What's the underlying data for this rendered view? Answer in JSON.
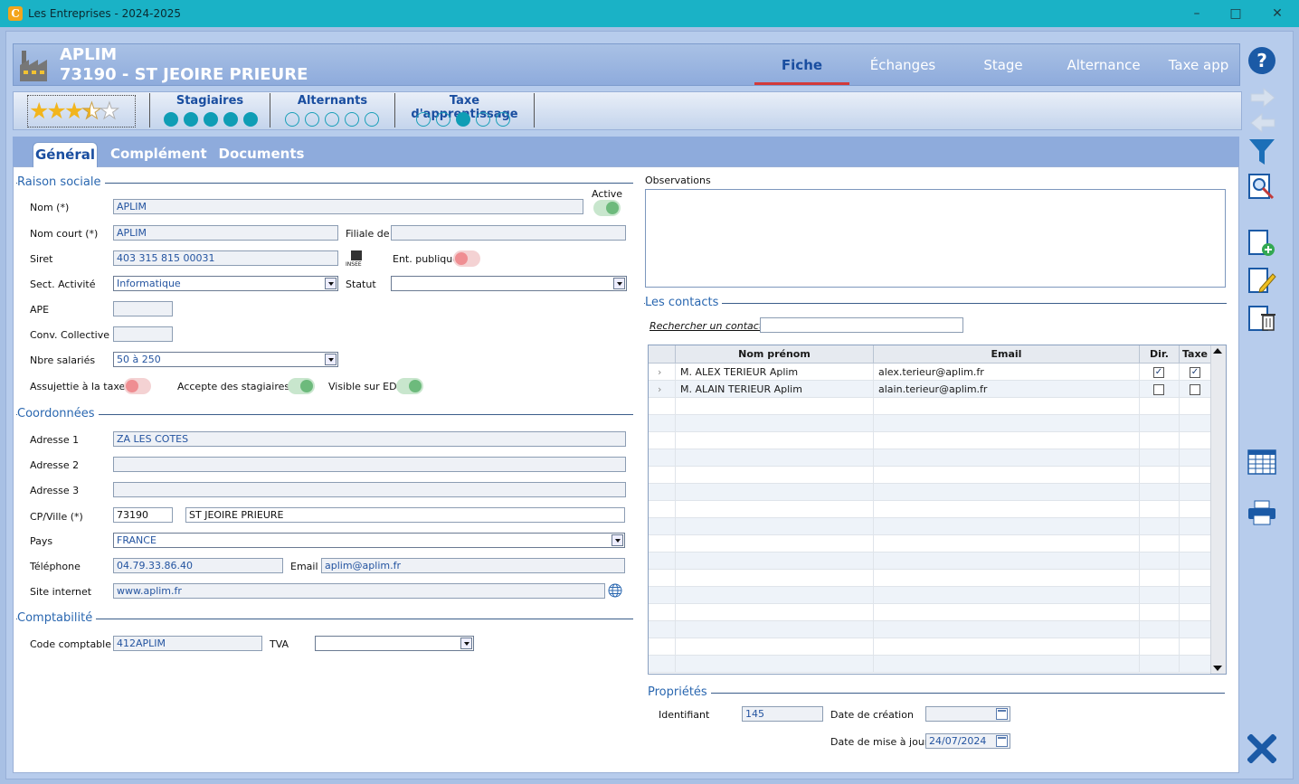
{
  "window": {
    "title": "Les Entreprises - 2024-2025",
    "app_icon": "C",
    "minimize": "–",
    "maximize": "□",
    "close": "✕"
  },
  "header": {
    "name": "APLIM",
    "city": "73190 - ST JEOIRE PRIEURE",
    "tabs": [
      {
        "label": "Fiche",
        "active": true
      },
      {
        "label": "Échanges"
      },
      {
        "label": "Stage"
      },
      {
        "label": "Alternance"
      },
      {
        "label": "Taxe app"
      }
    ]
  },
  "rating": {
    "value": 3.5,
    "max": 5
  },
  "groups": [
    {
      "title": "Stagiaires",
      "filled": [
        true,
        true,
        true,
        true,
        true
      ]
    },
    {
      "title": "Alternants",
      "filled": [
        false,
        false,
        false,
        false,
        false
      ]
    },
    {
      "title": "Taxe d'apprentissage",
      "filled": [
        false,
        false,
        true,
        false,
        false
      ]
    }
  ],
  "subtabs": [
    "Général",
    "Complément",
    "Documents"
  ],
  "raison": {
    "section": "Raison sociale",
    "active_label": "Active",
    "nom_label": "Nom (*)",
    "nom": "APLIM",
    "nom_court_label": "Nom court (*)",
    "nom_court": "APLIM",
    "filiale_label": "Filiale de",
    "filiale": "",
    "siret_label": "Siret",
    "siret": "403 315 815 00031",
    "insee": "INSEE",
    "ent_publique_label": "Ent. publique",
    "secteur_label": "Sect. Activité",
    "secteur": "Informatique",
    "statut_label": "Statut",
    "statut": "",
    "ape_label": "APE",
    "ape": "",
    "conv_label": "Conv. Collective",
    "conv": "",
    "salaries_label": "Nbre salariés",
    "salaries": "50 à 250",
    "assujettie_label": "Assujettie à la taxe",
    "stagiaires_label": "Accepte des stagiaires",
    "visible_label": "Visible sur ED"
  },
  "coord": {
    "section": "Coordonnées",
    "a1_label": "Adresse 1",
    "a1": "ZA LES COTES",
    "a2_label": "Adresse 2",
    "a2": "",
    "a3_label": "Adresse 3",
    "a3": "",
    "cp_label": "CP/Ville (*)",
    "cp": "73190",
    "ville": "ST JEOIRE PRIEURE",
    "pays_label": "Pays",
    "pays": "FRANCE",
    "tel_label": "Téléphone",
    "tel": "04.79.33.86.40",
    "email_label": "Email",
    "email": "aplim@aplim.fr",
    "site_label": "Site internet",
    "site": "www.aplim.fr"
  },
  "compta": {
    "section": "Comptabilité",
    "code_label": "Code comptable",
    "code": "412APLIM",
    "tva_label": "TVA",
    "tva": ""
  },
  "observations": {
    "label": "Observations",
    "text": ""
  },
  "contacts": {
    "section": "Les contacts",
    "search_label": "Rechercher un contact",
    "search": "",
    "columns": [
      "Nom prénom",
      "Email",
      "Dir.",
      "Taxe"
    ],
    "rows": [
      {
        "name": "M. ALEX TERIEUR Aplim",
        "email": "alex.terieur@aplim.fr",
        "dir": true,
        "taxe": true
      },
      {
        "name": "M. ALAIN TERIEUR Aplim",
        "email": "alain.terieur@aplim.fr",
        "dir": false,
        "taxe": false
      }
    ]
  },
  "props": {
    "section": "Propriétés",
    "id_label": "Identifiant",
    "id": "145",
    "creation_label": "Date de création",
    "creation": "",
    "maj_label": "Date de mise à jour",
    "maj": "24/07/2024"
  },
  "sidebar": [
    "help-icon",
    "next-icon",
    "previous-icon",
    "filter-icon",
    "search-icon",
    "new-record-icon",
    "edit-icon",
    "delete-icon",
    "table-icon",
    "print-icon",
    "close-icon"
  ],
  "colors": {
    "titlebar": "#1ab2c6",
    "accent": "#1a4ea0",
    "tab_underline": "#d23a3a",
    "toggle_on": "#6dba7c",
    "toggle_off": "#ef8e92",
    "dot": "#0f9db5"
  }
}
